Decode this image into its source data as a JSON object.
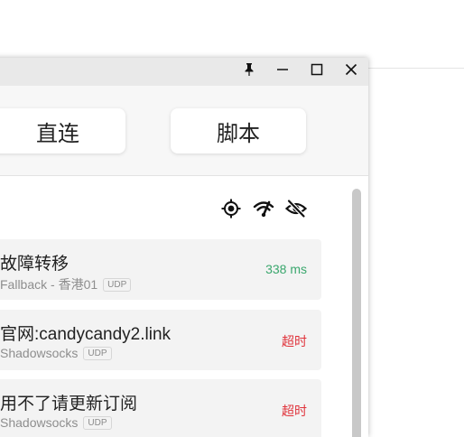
{
  "window": {
    "titlebar": {
      "pin_icon": "pin-icon",
      "minimize_icon": "minimize-icon",
      "maximize_icon": "maximize-icon",
      "close_icon": "close-icon"
    },
    "modes": {
      "direct_label": "直连",
      "script_label": "脚本"
    },
    "toolbar": {
      "locate_icon": "crosshair-icon",
      "delay_test_icon": "network-check-icon",
      "hide_icon": "eye-off-icon"
    },
    "proxies": [
      {
        "name": "故障转移",
        "type": "Fallback - 香港01",
        "udp": "UDP",
        "delay": "338 ms",
        "delay_color": "#3aa76d"
      },
      {
        "name": "官网:candycandy2.link",
        "type": "Shadowsocks",
        "udp": "UDP",
        "delay": "超时",
        "delay_color": "#e0323a"
      },
      {
        "name": "用不了请更新订阅",
        "type": "Shadowsocks",
        "udp": "UDP",
        "delay": "超时",
        "delay_color": "#e0323a"
      }
    ]
  }
}
